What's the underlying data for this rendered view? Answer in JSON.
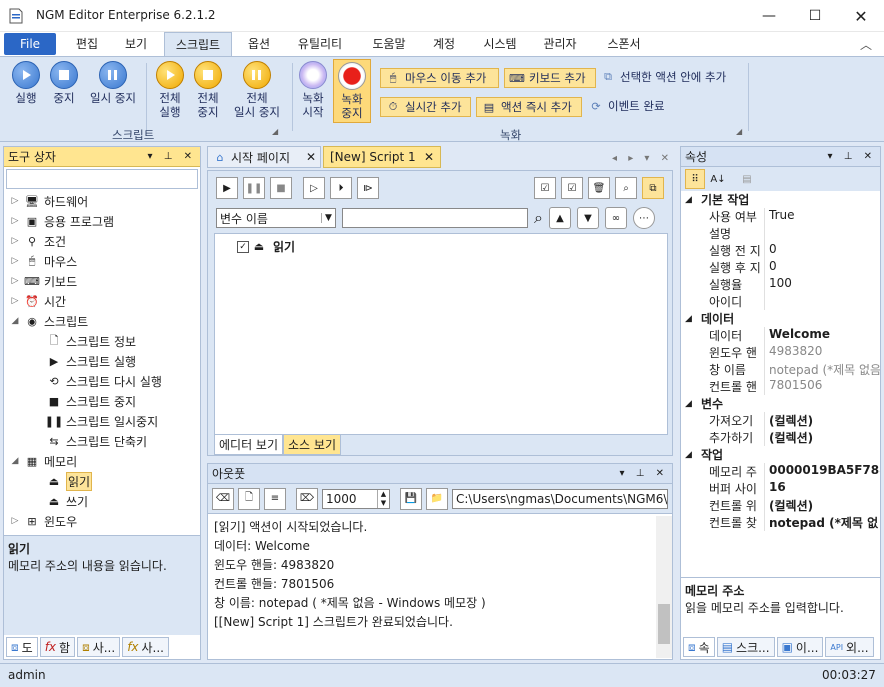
{
  "app": {
    "title": "NGM Editor",
    "edition": "Enterprise 6.2.1.2"
  },
  "menu": {
    "file": "File",
    "tabs": [
      "편집",
      "보기",
      "스크립트",
      "옵션",
      "유틸리티",
      "도움말",
      "계정",
      "시스템",
      "관리자",
      "스폰서"
    ]
  },
  "ribbon": {
    "b_run": "실행",
    "b_stop": "중지",
    "b_pause": "일시 중지",
    "b_allrun_1": "전체",
    "b_allrun_2": "실행",
    "b_allstop_1": "전체",
    "b_allstop_2": "중지",
    "b_allpause_1": "전체",
    "b_allpause_2": "일시 중지",
    "group_script": "스크립트",
    "b_rec_1": "녹화",
    "b_rec_2": "시작",
    "b_recstop_1": "녹화",
    "b_recstop_2": "중지",
    "b_mousemove": "마우스 이동 추가",
    "b_keyboard": "키보드 추가",
    "b_inside": "선택한 액션 안에 추가",
    "b_realtime": "실시간 추가",
    "b_immediate": "액션 즉시 추가",
    "b_event": "이벤트 완료",
    "group_record": "녹화"
  },
  "toolbox": {
    "title": "도구 상자",
    "items": [
      {
        "label": "하드웨어",
        "icon": "monitor-icon",
        "open": false
      },
      {
        "label": "응용 프로그램",
        "icon": "app-icon",
        "open": false
      },
      {
        "label": "조건",
        "icon": "condition-icon",
        "open": false
      },
      {
        "label": "마우스",
        "icon": "mouse-icon",
        "open": false
      },
      {
        "label": "키보드",
        "icon": "keyboard-icon",
        "open": false
      },
      {
        "label": "시간",
        "icon": "clock-icon",
        "open": false
      },
      {
        "label": "스크립트",
        "icon": "script-icon",
        "open": true
      }
    ],
    "script_children": [
      "스크립트 정보",
      "스크립트 실행",
      "스크립트 다시 실행",
      "스크립트 중지",
      "스크립트 일시중지",
      "스크립트 단축키"
    ],
    "memory": "메모리",
    "memory_children": [
      "읽기",
      "쓰기"
    ],
    "window": "윈도우",
    "desc_title": "읽기",
    "desc_text": "메모리 주소의 내용을 읽습니다.",
    "bottom_tabs": [
      "도",
      "함",
      "사...",
      "사..."
    ]
  },
  "editor": {
    "tab_start": "시작 페이지",
    "tab_script": "[New] Script 1",
    "var_select": "변수 이름",
    "action": "읽기",
    "view_tabs": [
      "에디터 보기",
      "소스 보기"
    ]
  },
  "output": {
    "title": "아웃풋",
    "count": "1000",
    "path": "C:\\Users\\ngmas\\Documents\\NGM6\\",
    "lines": [
      "[읽기] 액션이 시작되었습니다.",
      "데이터: Welcome",
      "윈도우 핸들: 4983820",
      "컨트롤 핸들: 7801506",
      "창 이름: notepad ( *제목 없음 - Windows 메모장 )",
      "[[New] Script 1] 스크립트가 완료되었습니다."
    ]
  },
  "props": {
    "title": "속성",
    "cat_basic": "기본 작업",
    "basic": [
      [
        "사용 여부",
        "True"
      ],
      [
        "설명",
        ""
      ],
      [
        "실행 전 지",
        "0"
      ],
      [
        "실행 후 지",
        "0"
      ],
      [
        "실행율",
        "100"
      ],
      [
        "아이디",
        ""
      ]
    ],
    "cat_data": "데이터",
    "data": [
      [
        "데이터",
        "Welcome",
        true
      ],
      [
        "윈도우 핸",
        "4983820",
        false
      ],
      [
        "창 이름",
        "notepad (*제목 없음",
        false
      ],
      [
        "컨트롤 핸",
        "7801506",
        false
      ]
    ],
    "cat_var": "변수",
    "var": [
      [
        "가져오기",
        "(컬렉션)"
      ],
      [
        "추가하기",
        "(컬렉션)"
      ]
    ],
    "cat_work": "작업",
    "work": [
      [
        "메모리 주",
        "0000019BA5F788C"
      ],
      [
        "버퍼 사이",
        "16"
      ],
      [
        "컨트롤 위",
        "(컬렉션)"
      ],
      [
        "컨트롤 찾",
        "notepad (*제목 없"
      ]
    ],
    "desc_title": "메모리 주소",
    "desc_text": "읽을 메모리 주소를 입력합니다.",
    "bottom_tabs": [
      "속",
      "스크...",
      "이...",
      "외..."
    ]
  },
  "status": {
    "user": "admin",
    "time": "00:03:27"
  }
}
